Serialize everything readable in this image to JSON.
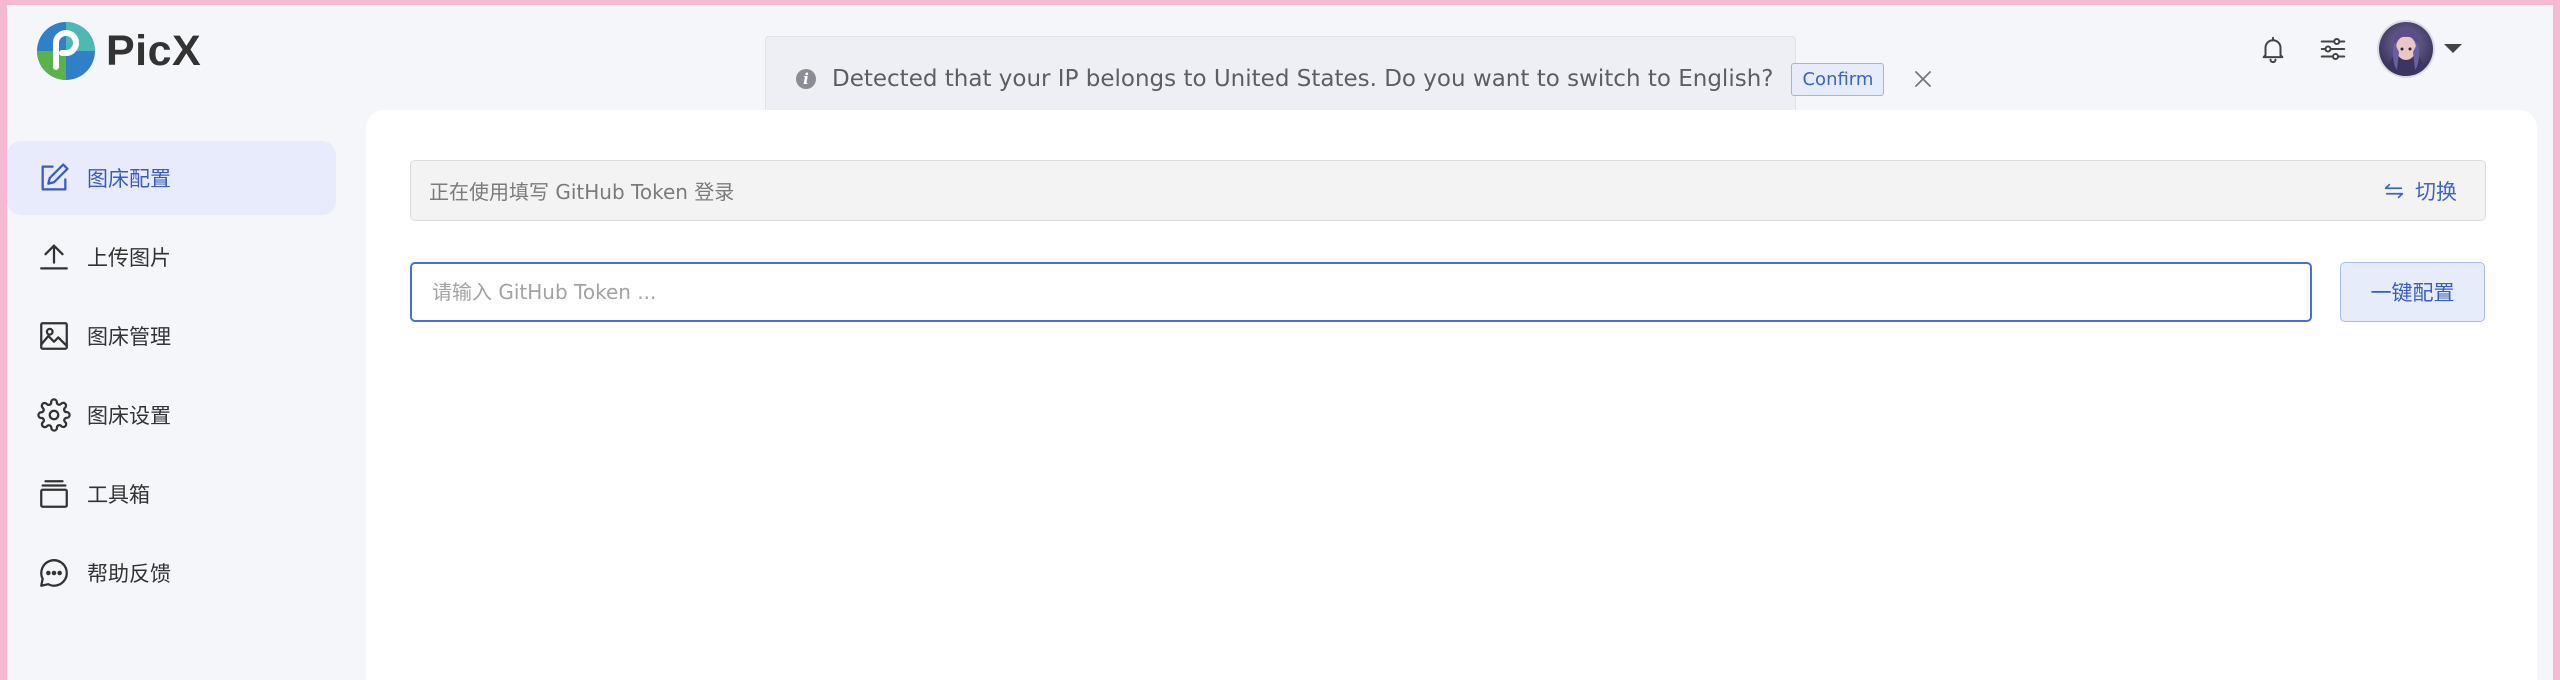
{
  "app": {
    "name": "PicX",
    "logo_icon": "picx-logo-icon",
    "brand_colors": {
      "blue": "#2f80c9",
      "green": "#59b34a",
      "teal": "#4fb8b4"
    }
  },
  "header": {
    "bell_icon": "bell-icon",
    "settings_icon": "sliders-icon",
    "avatar_icon": "user-avatar",
    "caret_icon": "caret-down-icon"
  },
  "notice": {
    "message": "Detected that your IP belongs to United States. Do you want to switch to English?",
    "confirm_label": "Confirm",
    "info_glyph": "i",
    "close_icon": "close-icon"
  },
  "sidebar": {
    "items": [
      {
        "label": "图床配置",
        "icon": "edit-icon",
        "active": true
      },
      {
        "label": "上传图片",
        "icon": "upload-icon",
        "active": false
      },
      {
        "label": "图床管理",
        "icon": "image-icon",
        "active": false
      },
      {
        "label": "图床设置",
        "icon": "gear-icon",
        "active": false
      },
      {
        "label": "工具箱",
        "icon": "toolbox-icon",
        "active": false
      },
      {
        "label": "帮助反馈",
        "icon": "chat-icon",
        "active": false
      }
    ]
  },
  "main": {
    "token_info": "正在使用填写 GitHub Token 登录",
    "switch_label": "切换",
    "switch_icon": "swap-icon",
    "token_placeholder": "请输入 GitHub Token ...",
    "token_value": "",
    "config_button": "一键配置"
  },
  "colors": {
    "page_border": "#f6b9d2",
    "background": "#f5f6fa",
    "accent": "#3c63c6",
    "active_nav_bg": "#e8ebfb"
  }
}
